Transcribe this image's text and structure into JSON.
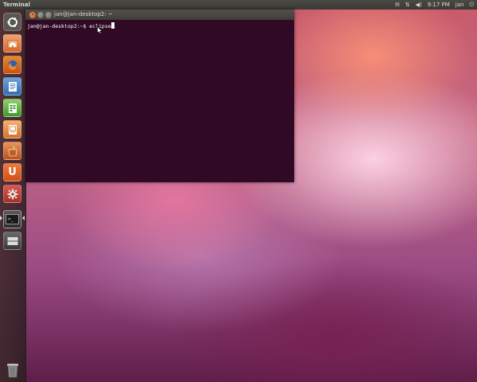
{
  "top_panel": {
    "app_name": "Terminal",
    "indicators": {
      "mail": "✉",
      "network": "⇅",
      "sound": "◀)",
      "clock": "9:17 PM",
      "user": "jan",
      "session": "⏻"
    }
  },
  "launcher": {
    "items": [
      {
        "name": "dash",
        "icon": "ubuntu-logo-icon"
      },
      {
        "name": "home-folder",
        "icon": "home-folder-icon"
      },
      {
        "name": "firefox",
        "icon": "firefox-icon"
      },
      {
        "name": "writer",
        "icon": "writer-icon"
      },
      {
        "name": "calc",
        "icon": "calc-icon"
      },
      {
        "name": "impress",
        "icon": "impress-icon"
      },
      {
        "name": "software-center",
        "icon": "shopping-bag-icon"
      },
      {
        "name": "ubuntu-one",
        "icon": "ubuntu-one-icon"
      },
      {
        "name": "system-settings",
        "icon": "gear-icon"
      },
      {
        "name": "terminal",
        "icon": "terminal-icon"
      },
      {
        "name": "workspaces",
        "icon": "workspace-switcher-icon"
      },
      {
        "name": "trash",
        "icon": "trash-icon"
      }
    ],
    "ubuntu_one_letter": "U",
    "terminal_glyph": ">_"
  },
  "terminal": {
    "title": "jan@jan-desktop2: ~",
    "close_glyph": "×",
    "prompt": "jan@jan-desktop2:~$",
    "command": " eclipse"
  },
  "colors": {
    "terminal_bg": "#300a24",
    "panel_bg": "#3c3b37",
    "accent_orange": "#dd4814"
  }
}
